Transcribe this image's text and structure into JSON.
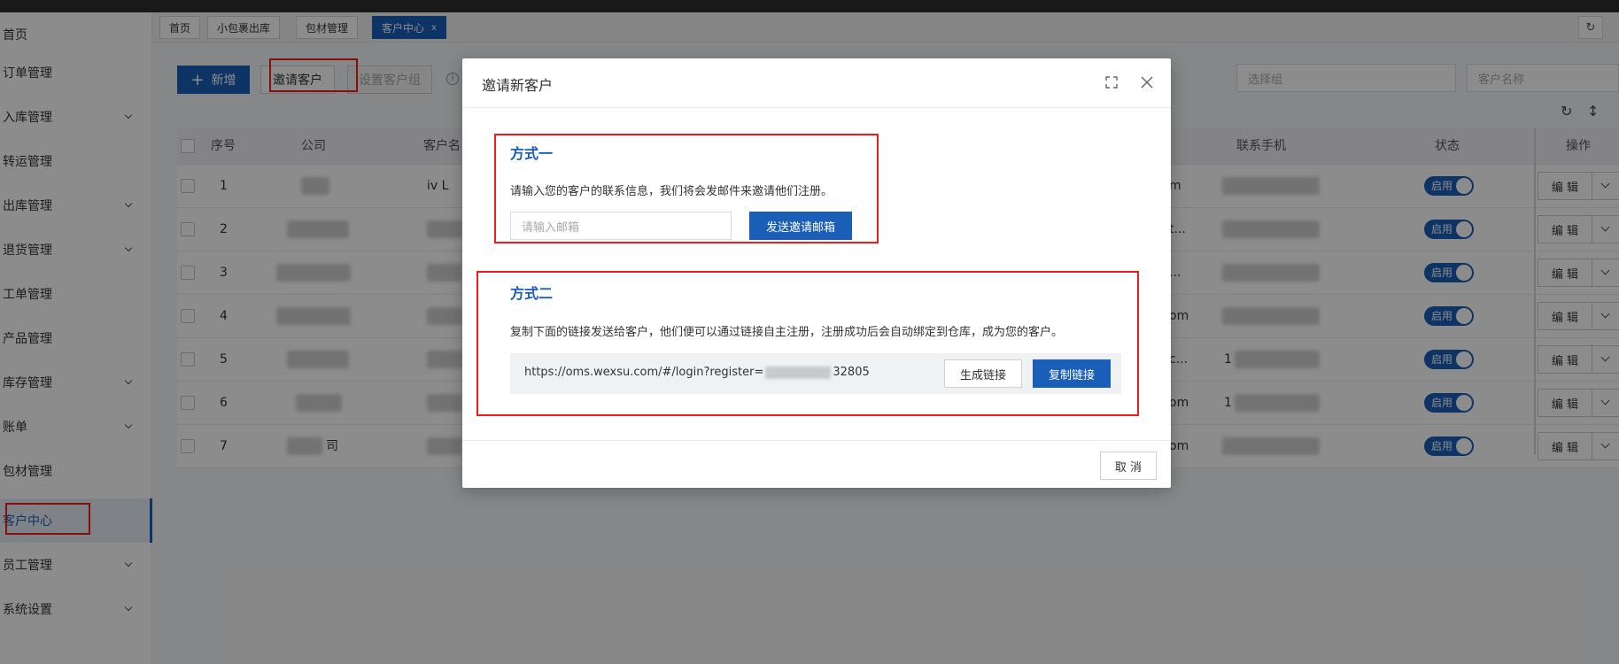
{
  "sidebar": {
    "items": [
      {
        "label": "首页",
        "has_arrow": false
      },
      {
        "label": "订单管理",
        "has_arrow": false
      },
      {
        "label": "入库管理",
        "has_arrow": true
      },
      {
        "label": "转运管理",
        "has_arrow": false
      },
      {
        "label": "出库管理",
        "has_arrow": true
      },
      {
        "label": "退货管理",
        "has_arrow": true
      },
      {
        "label": "工单管理",
        "has_arrow": false
      },
      {
        "label": "产品管理",
        "has_arrow": false
      },
      {
        "label": "库存管理",
        "has_arrow": true
      },
      {
        "label": "账单",
        "has_arrow": true
      },
      {
        "label": "包材管理",
        "has_arrow": false
      },
      {
        "label": "客户中心",
        "has_arrow": false,
        "active": true
      },
      {
        "label": "员工管理",
        "has_arrow": true
      },
      {
        "label": "系统设置",
        "has_arrow": true
      }
    ]
  },
  "tabs": [
    {
      "label": "首页"
    },
    {
      "label": "小包裹出库"
    },
    {
      "label": "包材管理"
    },
    {
      "label": "客户中心",
      "active": true,
      "close": "x"
    }
  ],
  "toolbar": {
    "add_label": "新增",
    "add_icon": "+",
    "invite_label": "邀请客户",
    "set_group_label": "设置客户组",
    "info_icon": "i",
    "group_placeholder": "选择组",
    "name_placeholder": "客户名称"
  },
  "table": {
    "headers": {
      "index": "序号",
      "company": "公司",
      "customer_name": "客户名",
      "phone": "联系手机",
      "status": "状态",
      "actions": "操作"
    },
    "rows": [
      {
        "index": "1",
        "name_prefix": "iv L",
        "email_suffix": "m",
        "phone_prefix": "",
        "status": "启用",
        "edit": "编 辑"
      },
      {
        "index": "2",
        "name_prefix": "",
        "email_suffix": "t...",
        "phone_prefix": "",
        "status": "启用",
        "edit": "编 辑"
      },
      {
        "index": "3",
        "name_prefix": "",
        "email_suffix": "...",
        "phone_prefix": "",
        "status": "启用",
        "edit": "编 辑"
      },
      {
        "index": "4",
        "name_prefix": "",
        "email_suffix": "om",
        "phone_prefix": "",
        "status": "启用",
        "edit": "编 辑"
      },
      {
        "index": "5",
        "name_prefix": "",
        "email_suffix": "c...",
        "phone_prefix": "1",
        "status": "启用",
        "edit": "编 辑"
      },
      {
        "index": "6",
        "name_prefix": "",
        "email_suffix": "om",
        "phone_prefix": "1",
        "status": "启用",
        "edit": "编 辑"
      },
      {
        "index": "7",
        "company_suffix": "司",
        "name_prefix": "",
        "email_suffix": "om",
        "phone_prefix": "",
        "status": "启用",
        "edit": "编 辑"
      }
    ]
  },
  "modal": {
    "title": "邀请新客户",
    "method1": {
      "title": "方式一",
      "desc": "请输入您的客户的联系信息，我们将会发邮件来邀请他们注册。",
      "email_placeholder": "请输入邮箱",
      "send_label": "发送邀请邮箱"
    },
    "method2": {
      "title": "方式二",
      "desc": "复制下面的链接发送给客户，他们便可以通过链接自主注册，注册成功后会自动绑定到仓库，成为您的客户。",
      "link_prefix": "https://oms.wexsu.com/#/login?register=",
      "link_suffix": "32805",
      "generate_label": "生成链接",
      "copy_label": "复制链接"
    },
    "cancel_label": "取 消"
  },
  "colors": {
    "primary": "#1a5eb8",
    "highlight": "#ee1c1c"
  }
}
